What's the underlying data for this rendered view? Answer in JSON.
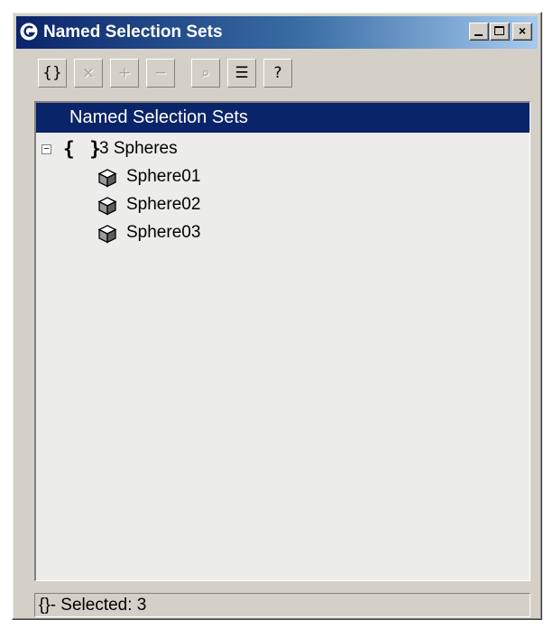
{
  "window": {
    "title": "Named Selection Sets",
    "controls": {
      "minimize": "_",
      "maximize": "□",
      "close": "×"
    }
  },
  "toolbar": {
    "buttons": [
      {
        "icon": "create-set-icon",
        "glyph": "{}",
        "enabled": true
      },
      {
        "icon": "delete-icon",
        "glyph": "×",
        "enabled": false
      },
      {
        "icon": "add-selected-icon",
        "glyph": "+",
        "enabled": false
      },
      {
        "icon": "subtract-selected-icon",
        "glyph": "−",
        "enabled": false
      },
      {
        "icon": "select-objects-icon",
        "glyph": "⌕",
        "enabled": false
      },
      {
        "icon": "select-by-name-icon",
        "glyph": "☰",
        "enabled": true
      },
      {
        "icon": "highlight-selected-icon",
        "glyph": "?",
        "enabled": true
      }
    ]
  },
  "list": {
    "header": "Named Selection Sets",
    "sets": [
      {
        "expander": "−",
        "icon": "{ }",
        "name": "3 Spheres",
        "objects": [
          {
            "name": "Sphere01",
            "icon": "cube-icon"
          },
          {
            "name": "Sphere02",
            "icon": "cube-icon"
          },
          {
            "name": "Sphere03",
            "icon": "cube-icon"
          }
        ]
      }
    ]
  },
  "status": {
    "text": "{}- Selected: 3"
  },
  "colors": {
    "title_start": "#0a246a",
    "title_end": "#a6caf0",
    "face": "#d4d0c8",
    "list_bg": "#ececea",
    "selection": "#0a246a"
  }
}
